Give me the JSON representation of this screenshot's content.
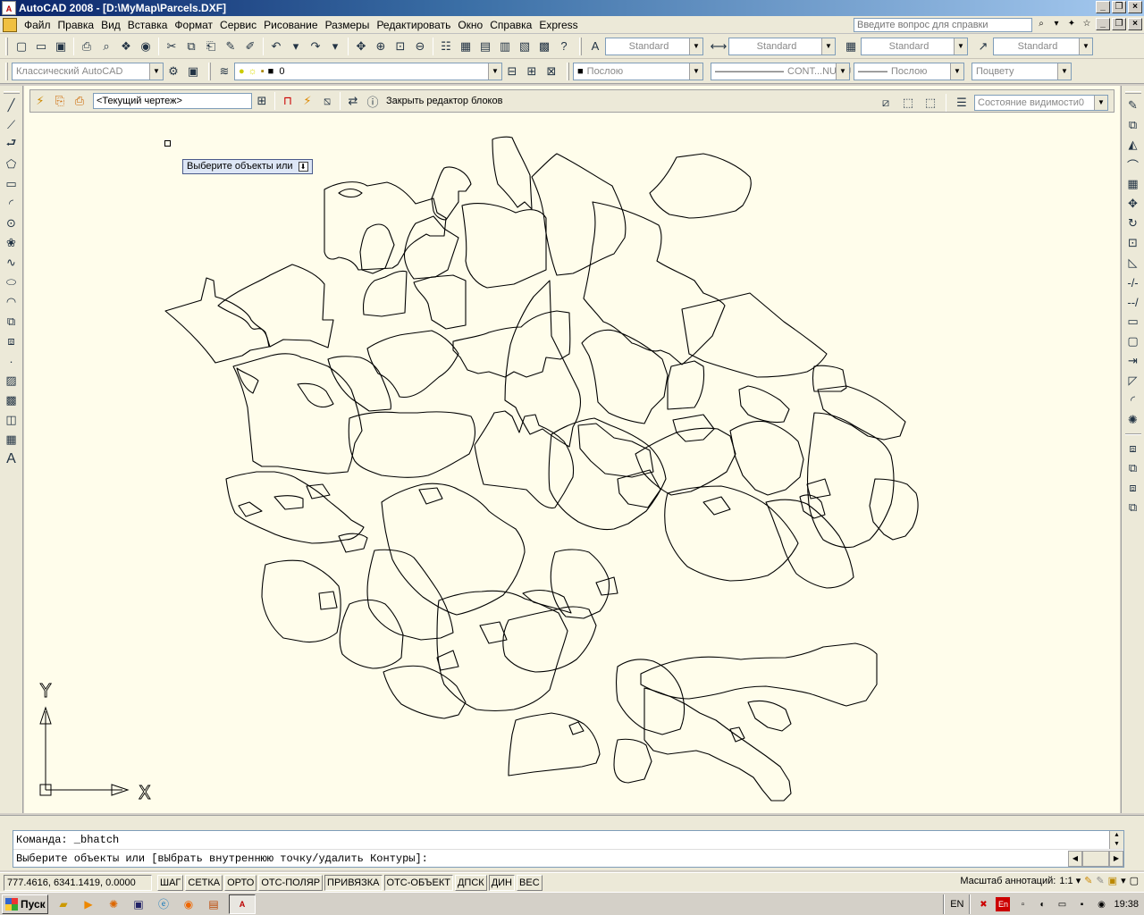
{
  "window": {
    "title": "AutoCAD 2008 - [D:\\MyMap\\Parcels.DXF]",
    "app_badge": "A"
  },
  "menu": {
    "items": [
      "Файл",
      "Правка",
      "Вид",
      "Вставка",
      "Формат",
      "Сервис",
      "Рисование",
      "Размеры",
      "Редактировать",
      "Окно",
      "Справка",
      "Express"
    ],
    "help_placeholder": "Введите вопрос для справки"
  },
  "toolbar1": {
    "text_style": "Standard",
    "dim_style": "Standard",
    "table_style": "Standard",
    "multileader_style": "Standard"
  },
  "toolbar2": {
    "workspace": "Классический AutoCAD",
    "layer": "0",
    "color": "Послою",
    "linetype": "CONT...NUOU",
    "lineweight": "Послою",
    "plotstyle": "Поцвету"
  },
  "block_editor": {
    "current_drawing": "<Текущий чертеж>",
    "close_label": "Закрыть редактор блоков",
    "visibility_state": "Состояние видимости0"
  },
  "canvas": {
    "tooltip": "Выберите объекты или",
    "ucs_x": "X",
    "ucs_y": "Y"
  },
  "command": {
    "line1": "Команда: _bhatch",
    "line2": "Выберите объекты или [вЫбрать внутреннюю точку/удалить Контуры]:"
  },
  "status": {
    "coords": "777.4616, 6341.1419, 0.0000",
    "toggles": [
      "ШАГ",
      "СЕТКА",
      "ОРТО",
      "ОТС-ПОЛЯР",
      "ПРИВЯЗКА",
      "ОТС-ОБЪЕКТ",
      "ДПСК",
      "ДИН",
      "ВЕС"
    ],
    "annotation_scale_label": "Масштаб аннотаций:",
    "annotation_scale": "1:1"
  },
  "taskbar": {
    "start": "Пуск",
    "lang": "EN",
    "lang_badge": "En",
    "time": "19:38"
  }
}
